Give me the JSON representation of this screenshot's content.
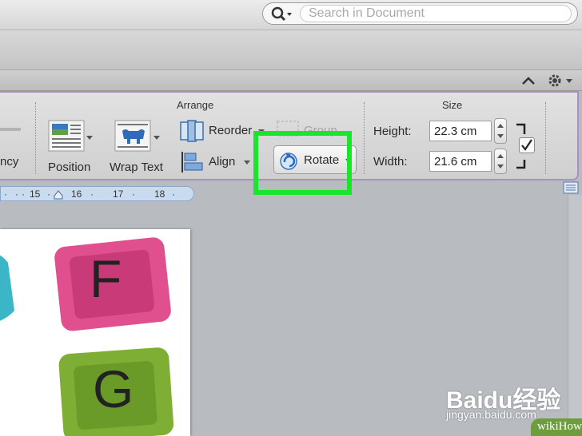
{
  "search": {
    "placeholder": "Search in Document"
  },
  "ribbon": {
    "arrange_label": "Arrange",
    "size_label": "Size",
    "transparency_partial": "ncy",
    "position_label": "Position",
    "wrap_text_label": "Wrap Text",
    "reorder_label": "Reorder",
    "align_label": "Align",
    "group_label": "Group",
    "rotate_label": "Rotate",
    "height_label": "Height:",
    "height_value": "22.3 cm",
    "width_label": "Width:",
    "width_value": "21.6 cm"
  },
  "ruler": {
    "ticks": [
      "15",
      "16",
      "17",
      "18"
    ]
  },
  "document": {
    "letters": [
      "F",
      "G"
    ]
  },
  "watermarks": {
    "baidu": "Baidu经验",
    "url": "jingyan.baidu.com",
    "wikihow": "wikiHow"
  },
  "colors": {
    "highlight": "#17e62a",
    "ribbon_border": "#a98fc2",
    "block_pink": "#e0508e",
    "block_green": "#7fae34",
    "block_teal": "#3ab6c6"
  }
}
